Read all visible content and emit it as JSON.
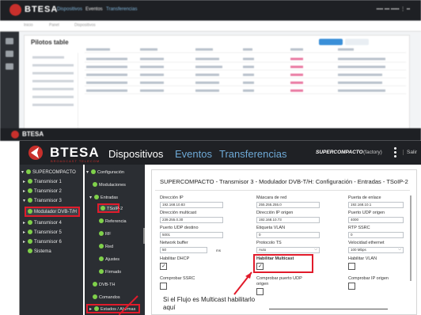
{
  "background": {
    "brand": "BTESA",
    "nav": [
      "Dispositivos",
      "Eventos",
      "Transferencias"
    ],
    "breadcrumb": [
      "Inicio",
      "Panel",
      "Dispositivos"
    ],
    "panel_title": "Pilotos table"
  },
  "header": {
    "brand": "BTESA",
    "brand_sub": "BROADCAST TELECOM",
    "nav": [
      "Dispositivos",
      "Eventos",
      "Transferencias"
    ],
    "device": "SUPERCOMPACTO",
    "mode": "(factory)",
    "logout": "Salir"
  },
  "tree": [
    {
      "label": "SUPERCOMPACTO",
      "expanded": true,
      "level": 0
    },
    {
      "label": "Transmisor 1",
      "expanded": false,
      "level": 1
    },
    {
      "label": "Transmisor 2",
      "expanded": false,
      "level": 1
    },
    {
      "label": "Transmisor 3",
      "expanded": true,
      "level": 1
    },
    {
      "label": "Modulador DVB-T/H",
      "selected": true,
      "level": 2
    },
    {
      "label": "Transmisor 4",
      "expanded": false,
      "level": 1
    },
    {
      "label": "Transmisor 5",
      "expanded": false,
      "level": 1
    },
    {
      "label": "Transmisor 6",
      "expanded": false,
      "level": 1
    },
    {
      "label": "Sistema",
      "level": 1
    }
  ],
  "subtree": [
    {
      "label": "Configuración"
    },
    {
      "label": "Modulaciones"
    },
    {
      "label": "Entradas"
    },
    {
      "label": "TSoIP-2",
      "selected": true
    },
    {
      "label": "Referencia"
    },
    {
      "label": "RF"
    },
    {
      "label": "Red"
    },
    {
      "label": "Ajustes"
    },
    {
      "label": "Firmado"
    },
    {
      "label": "DVB-TH"
    },
    {
      "label": "Comandos"
    },
    {
      "label": "Estados / Alarmas",
      "highlighted": true
    }
  ],
  "content": {
    "title": "SUPERCOMPACTO - Transmisor 3 - Modulador DVB-T/H: Configuración - Entradas - TSoIP-2",
    "fields": {
      "ip_label": "Dirección IP",
      "ip_value": "192.168.10.83",
      "mask_label": "Máscara de red",
      "mask_value": "255.255.255.0",
      "gw_label": "Puerta de enlace",
      "gw_value": "192.168.10.1",
      "mcast_label": "Dirección multicast",
      "mcast_value": "239.255.0.30",
      "src_ip_label": "Dirección IP origen",
      "src_ip_value": "192.168.10.73",
      "src_port_label": "Puerto UDP origen",
      "src_port_value": "4000",
      "dst_port_label": "Puerto UDP destino",
      "dst_port_value": "5001",
      "vlan_label": "Etiqueta VLAN",
      "vlan_value": "0",
      "ssrc_label": "RTP SSRC",
      "ssrc_value": "0",
      "buffer_label": "Network buffer",
      "buffer_value": "50",
      "buffer_unit": "ms",
      "proto_label": "Protocolo TS",
      "proto_value": "Auto",
      "eth_label": "Velocidad ethernet",
      "eth_value": "100 Mbps",
      "dhcp_label": "Habilitar DHCP",
      "dhcp_checked": true,
      "multicast_label": "Habilitar Multicast",
      "multicast_checked": true,
      "vlan_en_label": "Habilitar VLAN",
      "vlan_en_checked": false,
      "chk_ssrc_label": "Comprobar SSRC",
      "chk_ssrc_checked": false,
      "chk_port_label": "Comprobar puerto UDP",
      "chk_port_label2": "origen",
      "chk_port_checked": false,
      "chk_ip_label": "Comprobar IP origen",
      "chk_ip_checked": false
    }
  },
  "annotation": {
    "line1": "Si el Flujo es Multicast habilitarlo",
    "line2": "aquí"
  },
  "colors": {
    "header_bg": "#1f2125",
    "tree_bg": "#2b2e33",
    "status_green": "#7fd14a",
    "highlight_red": "#e11b2b",
    "nav_blue": "#6ea9d6"
  }
}
